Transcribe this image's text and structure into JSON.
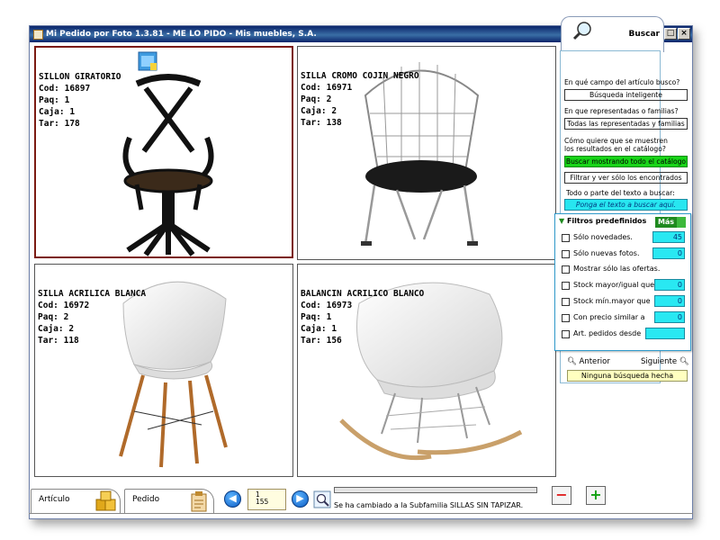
{
  "window": {
    "title": "Mi Pedido por Foto 1.3.81  - ME LO PIDO - Mis muebles, S.A.",
    "controls": [
      "_",
      "□",
      "×"
    ]
  },
  "products": [
    {
      "name": "SILLON GIRATORIO",
      "cod": "Cod: 16897",
      "paq": "Paq: 1",
      "caja": "Caja: 1",
      "tar": "Tar: 178",
      "selected": true
    },
    {
      "name": "SILLA CROMO COJIN NEGRO",
      "cod": "Cod: 16971",
      "paq": "Paq: 2",
      "caja": "Caja: 2",
      "tar": "Tar: 138",
      "selected": false
    },
    {
      "name": "SILLA ACRILICA BLANCA",
      "cod": "Cod: 16972",
      "paq": "Paq: 2",
      "caja": "Caja: 2",
      "tar": "Tar: 118",
      "selected": false
    },
    {
      "name": "BALANCIN ACRILICO BLANCO",
      "cod": "Cod: 16973",
      "paq": "Paq: 1",
      "caja": "Caja: 1",
      "tar": "Tar: 156",
      "selected": false
    }
  ],
  "search": {
    "tab_label": "Buscar",
    "q1": "En qué campo del artículo busco?",
    "field1": "Búsqueda inteligente",
    "q2": "En que representadas o familias?",
    "field2": "Todas las representadas y familias",
    "q3_line1": "Cómo quiere que se muestren",
    "q3_line2": "los resultados en el catálogo?",
    "option_all": "Buscar mostrando todo el catálogo",
    "option_filter": "Filtrar y ver sólo los encontrados",
    "q4": "Todo o parte del texto a buscar:",
    "text_placeholder": "Ponga el texto a buscar aquí.",
    "prev": "Anterior",
    "next": "Siguiente",
    "status": "Ninguna búsqueda hecha"
  },
  "filters": {
    "header": "Filtros predefinidos",
    "more": "Más",
    "rows": [
      {
        "label": "Sólo novedades.",
        "value": "45"
      },
      {
        "label": "Sólo nuevas fotos.",
        "value": "0"
      },
      {
        "label": "Mostrar sólo las ofertas.",
        "value": ""
      },
      {
        "label": "Stock mayor/igual que",
        "value": "0"
      },
      {
        "label": "Stock mín.mayor que",
        "value": "0"
      },
      {
        "label": "Con precio similar a",
        "value": "0"
      },
      {
        "label": "Art. pedidos desde",
        "value": ""
      }
    ]
  },
  "bottom": {
    "tab_articulo": "Artículo",
    "tab_pedido": "Pedido",
    "page_current": "1",
    "page_total": "155",
    "status_text": "Se ha cambiado a la Subfamilia SILLAS SIN TAPIZAR.",
    "minus": "−",
    "plus": "+"
  },
  "colors": {
    "accent_green": "#17d417",
    "field_cyan": "#29e8f2",
    "selected_border": "#7b1a12",
    "title_blue": "#0a246a"
  }
}
